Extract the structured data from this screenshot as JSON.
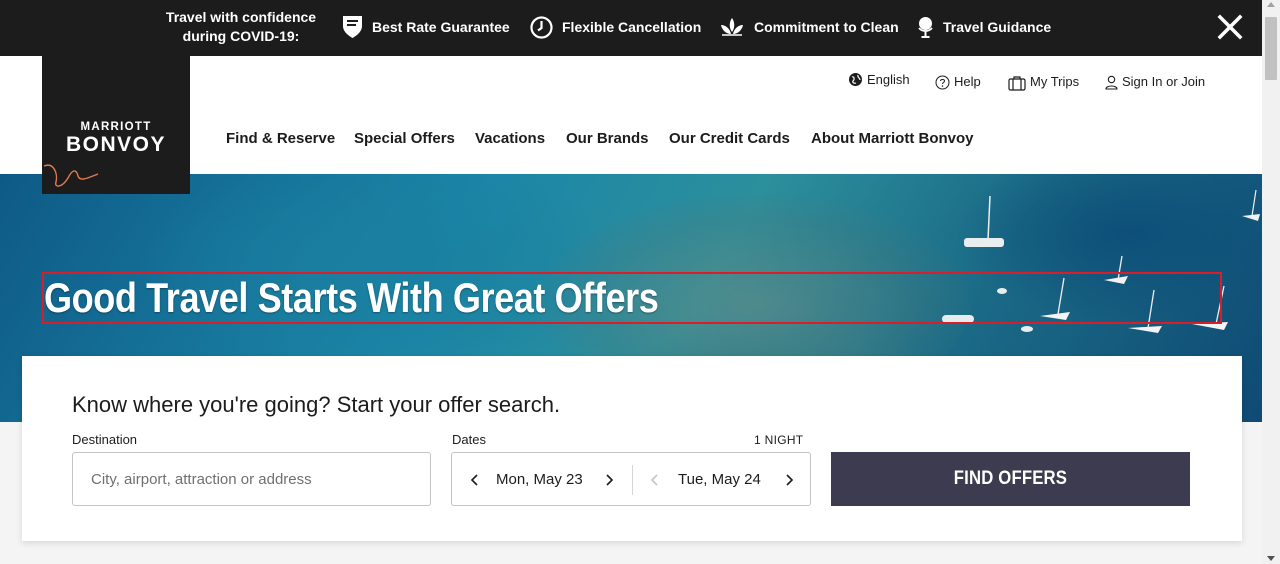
{
  "covid_banner": {
    "title_line1": "Travel with confidence",
    "title_line2": "during COVID-19:",
    "items": [
      {
        "label": "Best Rate Guarantee",
        "icon": "shield-flag-icon"
      },
      {
        "label": "Flexible Cancellation",
        "icon": "clock-icon"
      },
      {
        "label": "Commitment to Clean",
        "icon": "lotus-icon"
      },
      {
        "label": "Travel Guidance",
        "icon": "globe-stand-icon"
      }
    ],
    "close_icon": "close-icon"
  },
  "logo": {
    "top_text": "MARRIOTT",
    "main_text": "BONVOY"
  },
  "utility_links": [
    {
      "label": "English",
      "icon": "globe-icon"
    },
    {
      "label": "Help",
      "icon": "help-circle-icon"
    },
    {
      "label": "My Trips",
      "icon": "suitcase-icon"
    },
    {
      "label": "Sign In or Join",
      "icon": "user-icon"
    }
  ],
  "nav": [
    "Find & Reserve",
    "Special Offers",
    "Vacations",
    "Our Brands",
    "Our Credit Cards",
    "About Marriott Bonvoy"
  ],
  "hero": {
    "headline": "Good Travel Starts With Great Offers"
  },
  "search": {
    "title": "Know where you're going? Start your offer search.",
    "destination_label": "Destination",
    "destination_placeholder": "City, airport, attraction or address",
    "destination_value": "",
    "dates_label": "Dates",
    "nights": "1 NIGHT",
    "check_in": "Mon, May 23",
    "check_out": "Tue, May 24",
    "button_label": "FIND OFFERS"
  },
  "colors": {
    "banner_bg": "#1c1c1c",
    "button_bg": "#3d3b4f",
    "highlight_box": "#d91e2a",
    "logo_accent": "#e07a52"
  }
}
